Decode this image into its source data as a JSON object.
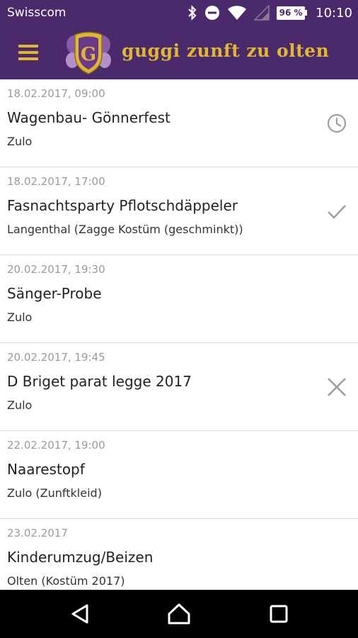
{
  "status_bar": {
    "carrier": "Swisscom",
    "battery": "96 %",
    "time": "10:10"
  },
  "app_bar": {
    "title": "guggi zunft zu olten",
    "crest_letter": "G",
    "menu_icon": "hamburger-menu-icon"
  },
  "events": [
    {
      "date": "18.02.2017, 09:00",
      "title": "Wagenbau- Gönnerfest",
      "place": "Zulo",
      "status": "pending"
    },
    {
      "date": "18.02.2017, 17:00",
      "title": "Fasnachtsparty Pflotschdäppeler",
      "place": "Langenthal (Zagge Kostüm (geschminkt))",
      "status": "accepted"
    },
    {
      "date": "20.02.2017, 19:30",
      "title": "Sänger-Probe",
      "place": "Zulo",
      "status": "none"
    },
    {
      "date": "20.02.2017, 19:45",
      "title": "D Briget parat legge 2017",
      "place": "Zulo",
      "status": "declined"
    },
    {
      "date": "22.02.2017, 19:00",
      "title": "Naarestopf",
      "place": "Zulo (Zunftkleid)",
      "status": "none"
    },
    {
      "date": "23.02.2017",
      "title": "Kinderumzug/Beizen",
      "place": "Olten (Kostüm 2017)",
      "status": "none"
    }
  ],
  "colors": {
    "brand_purple": "#4a2a6b",
    "brand_gold": "#e0b632",
    "status_icon_gray": "#9e9e9e"
  }
}
